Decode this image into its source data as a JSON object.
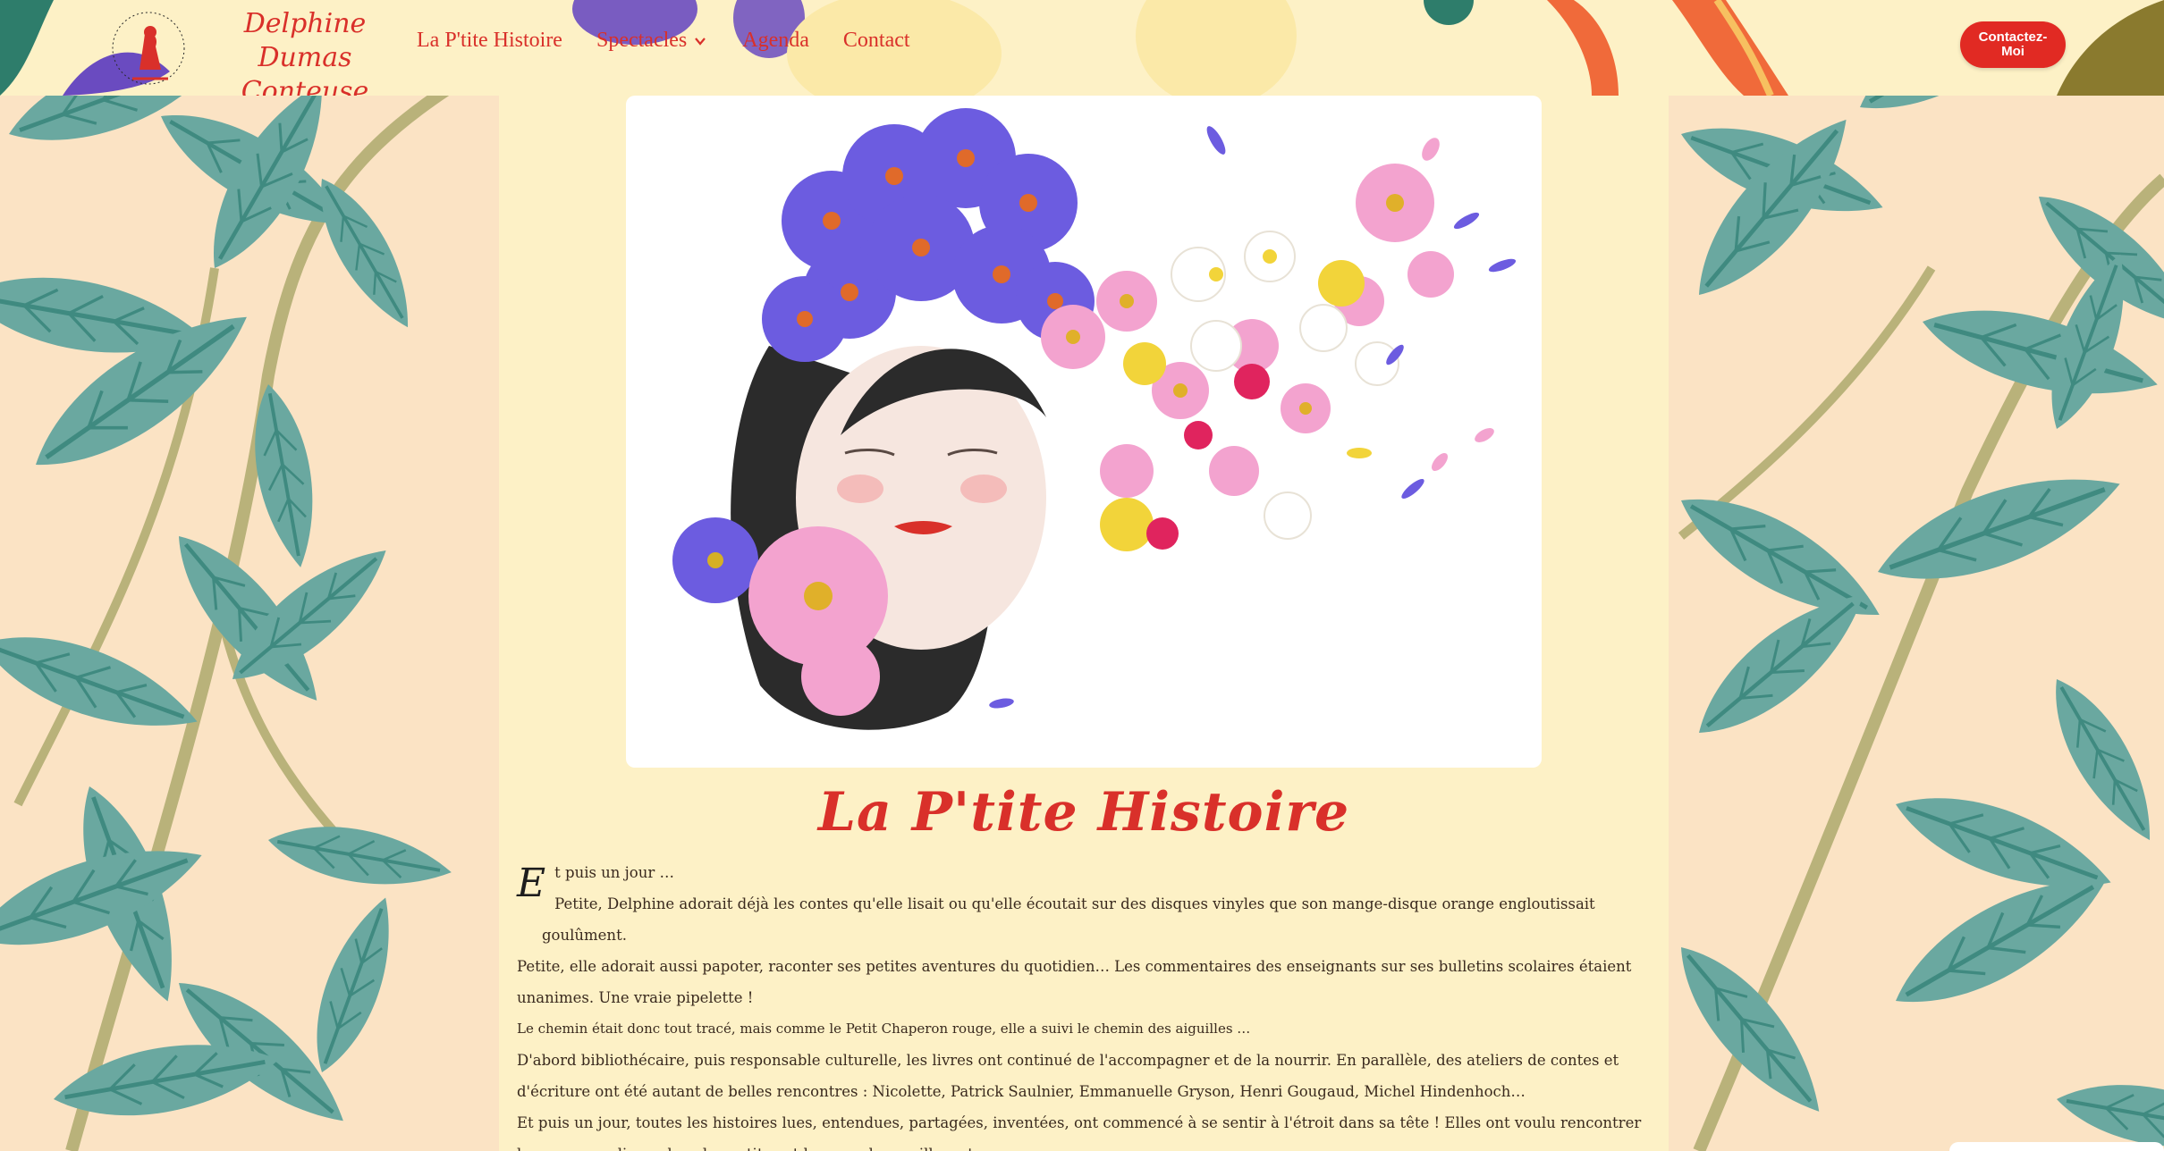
{
  "header": {
    "logo_line1": "Delphine Dumas",
    "logo_line2": "Conteuse",
    "logo_mark_text": "Delphine Dumas Conteuse",
    "nav": [
      {
        "label": "La P'tite Histoire",
        "has_dropdown": false
      },
      {
        "label": "Spectacles",
        "has_dropdown": true
      },
      {
        "label": "Agenda",
        "has_dropdown": false
      },
      {
        "label": "Contact",
        "has_dropdown": false
      }
    ],
    "cta_label": "Contactez-Moi"
  },
  "main": {
    "hero_icon": "woman-with-flowers-illustration",
    "title": "La P'tite Histoire",
    "dropcap": "E",
    "paragraphs": [
      "t puis un jour …",
      "Petite, Delphine adorait déjà les contes qu'elle lisait ou qu'elle écoutait sur des disques vinyles que son mange-disque orange engloutissait goulûment.",
      "Petite, elle adorait aussi papoter, raconter ses petites aventures du quotidien… Les commentaires des enseignants sur ses bulletins scolaires étaient unanimes. Une vraie pipelette !",
      "Le chemin était donc tout tracé, mais comme le Petit Chaperon rouge, elle a suivi le chemin des aiguilles …",
      "D'abord bibliothécaire, puis responsable culturelle, les livres ont continué de l'accompagner et de la nourrir. En parallèle, des ateliers de contes et d'écriture ont été autant de belles rencontres : Nicolette, Patrick Saulnier, Emmanuelle Gryson, Henri Gougaud, Michel Hindenhoch…",
      "Et puis un jour, toutes les histoires lues, entendues, partagées, inventées, ont commencé à se sentir à l'étroit dans sa tête ! Elles ont voulu rencontrer les gens, se glisser dans les petites et les grandes oreilles, et voyager…"
    ]
  },
  "colors": {
    "brand_red": "#d9302a",
    "cta_red": "#e12a23",
    "content_bg": "#fdf1c6",
    "leaf_teal": "#6aa8a0",
    "page_bg": "#fbe3c4"
  }
}
